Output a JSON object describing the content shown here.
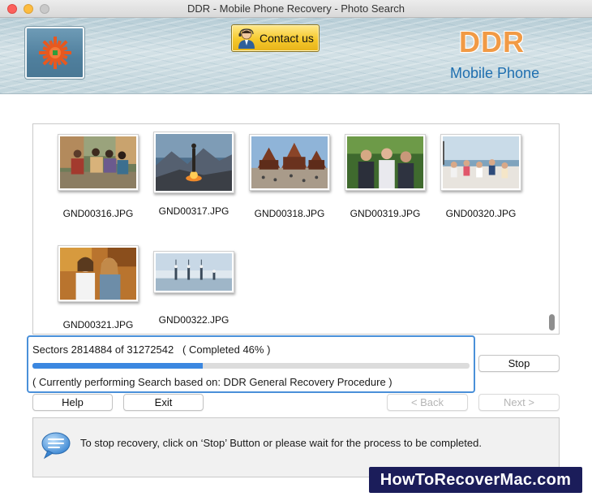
{
  "window": {
    "title": "DDR - Mobile Phone Recovery - Photo Search"
  },
  "header": {
    "contact_label": "Contact us",
    "brand_name": "DDR",
    "brand_subtitle": "Mobile Phone"
  },
  "photos": [
    {
      "name": "GND00316.JPG"
    },
    {
      "name": "GND00317.JPG"
    },
    {
      "name": "GND00318.JPG"
    },
    {
      "name": "GND00319.JPG"
    },
    {
      "name": "GND00320.JPG"
    },
    {
      "name": "GND00321.JPG"
    },
    {
      "name": "GND00322.JPG"
    }
  ],
  "progress": {
    "sectors_text": "Sectors 2814884 of 31272542   ( Completed 46% )",
    "sectors_done": 2814884,
    "sectors_total": 31272542,
    "percent_label": 46,
    "bar_fill_fraction": 0.39,
    "procedure_text": "( Currently performing Search based on: DDR General Recovery Procedure )"
  },
  "buttons": {
    "stop": "Stop",
    "help": "Help",
    "exit": "Exit",
    "back": "< Back",
    "next": "Next >"
  },
  "info": {
    "message": "To stop recovery, click on ‘Stop’ Button or please wait for the process to be completed."
  },
  "watermark": {
    "text": "HowToRecoverMac.com"
  },
  "colors": {
    "accent_blue": "#3b87e0",
    "focus_border": "#4a90d9",
    "brand_orange": "#f19a45",
    "brand_blue": "#1f6fb0",
    "contact_gold": "#f5c82b",
    "watermark_bg": "#1b1d5a"
  }
}
